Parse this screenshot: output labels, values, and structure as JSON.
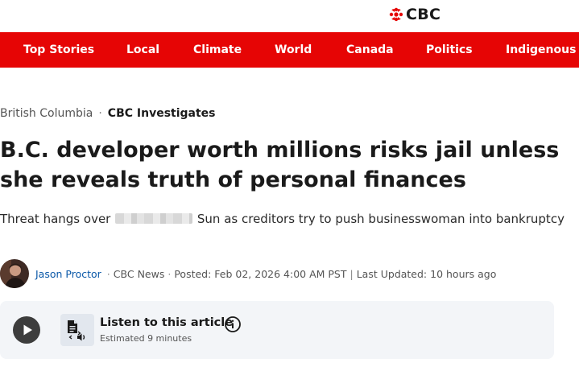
{
  "brand": {
    "logo_text": "CBC",
    "logo_icon": "cbc-gem-icon",
    "brand_color": "#e60505"
  },
  "nav": {
    "items": [
      {
        "label": "Top Stories"
      },
      {
        "label": "Local"
      },
      {
        "label": "Climate"
      },
      {
        "label": "World"
      },
      {
        "label": "Canada"
      },
      {
        "label": "Politics"
      },
      {
        "label": "Indigenous"
      }
    ]
  },
  "breadcrumb": {
    "section": "British Columbia",
    "separator": "·",
    "subsection": "CBC Investigates"
  },
  "article": {
    "headline": "B.C. developer worth millions risks jail unless she reveals truth of personal finances",
    "deck_before": "Threat hangs over",
    "deck_after": "Sun as creditors try to push businesswoman into bankruptcy",
    "author": "Jason Proctor",
    "source": "CBC News",
    "posted": "Posted: Feb 02, 2026 4:00 AM PST",
    "divider": "|",
    "updated": "Last Updated: 10 hours ago",
    "meta_separator": "·"
  },
  "listen": {
    "title": "Listen to this article",
    "estimate": "Estimated 9 minutes",
    "play_icon": "play-icon",
    "tts_icon": "text-to-speech-icon",
    "info_icon": "info-icon"
  }
}
